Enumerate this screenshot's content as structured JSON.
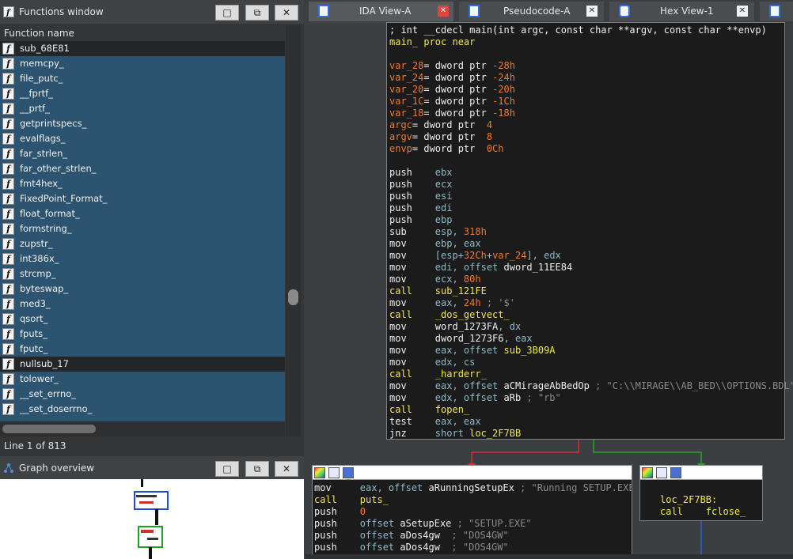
{
  "functions_window": {
    "title": "Functions window",
    "column_header": "Function name",
    "items": [
      "sub_68E81",
      "memcpy_",
      "file_putc_",
      "__fprtf_",
      "__prtf_",
      "getprintspecs_",
      "evalflags_",
      "far_strlen_",
      "far_other_strlen_",
      "fmt4hex_",
      "FixedPoint_Format_",
      "float_format_",
      "formstring_",
      "zupstr_",
      "int386x_",
      "strcmp_",
      "byteswap_",
      "med3_",
      "qsort_",
      "fputs_",
      "fputc_",
      "nullsub_17",
      "tolower_",
      "__set_errno_",
      "__set_doserrno_"
    ],
    "icon_glyph": "f",
    "status": "Line 1 of 813",
    "btn_max": "□",
    "btn_restore": "⧉",
    "btn_close": "✕"
  },
  "graph_overview": {
    "title": "Graph overview",
    "btn_max": "□",
    "btn_restore": "⧉",
    "btn_close": "✕"
  },
  "tabs": [
    {
      "label": "IDA View-A",
      "active": true
    },
    {
      "label": "Pseudocode-A",
      "active": false
    },
    {
      "label": "Hex View-1",
      "active": false
    }
  ],
  "close_glyph": "✕",
  "main_block_lines": [
    [
      {
        "t": "; int __cdecl main(int argc, const char **argv, const char **envp)",
        "c": "c-white"
      }
    ],
    [
      {
        "t": "main_ proc near",
        "c": "c-yellow"
      }
    ],
    [
      {
        "t": "",
        "c": "c-white"
      }
    ],
    [
      {
        "t": "var_28",
        "c": "c-orange"
      },
      {
        "t": "= dword ptr ",
        "c": "c-white"
      },
      {
        "t": "-28h",
        "c": "c-orange"
      }
    ],
    [
      {
        "t": "var_24",
        "c": "c-orange"
      },
      {
        "t": "= dword ptr ",
        "c": "c-white"
      },
      {
        "t": "-24h",
        "c": "c-orange"
      }
    ],
    [
      {
        "t": "var_20",
        "c": "c-orange"
      },
      {
        "t": "= dword ptr ",
        "c": "c-white"
      },
      {
        "t": "-20h",
        "c": "c-orange"
      }
    ],
    [
      {
        "t": "var_1C",
        "c": "c-orange"
      },
      {
        "t": "= dword ptr ",
        "c": "c-white"
      },
      {
        "t": "-1Ch",
        "c": "c-orange"
      }
    ],
    [
      {
        "t": "var_18",
        "c": "c-orange"
      },
      {
        "t": "= dword ptr ",
        "c": "c-white"
      },
      {
        "t": "-18h",
        "c": "c-orange"
      }
    ],
    [
      {
        "t": "argc",
        "c": "c-orange"
      },
      {
        "t": "= dword ptr  ",
        "c": "c-white"
      },
      {
        "t": "4",
        "c": "c-orange"
      }
    ],
    [
      {
        "t": "argv",
        "c": "c-orange"
      },
      {
        "t": "= dword ptr  ",
        "c": "c-white"
      },
      {
        "t": "8",
        "c": "c-orange"
      }
    ],
    [
      {
        "t": "envp",
        "c": "c-orange"
      },
      {
        "t": "= dword ptr  ",
        "c": "c-white"
      },
      {
        "t": "0Ch",
        "c": "c-orange"
      }
    ],
    [
      {
        "t": "",
        "c": "c-white"
      }
    ],
    [
      {
        "t": "push    ",
        "c": "c-white"
      },
      {
        "t": "ebx",
        "c": "c-teal"
      }
    ],
    [
      {
        "t": "push    ",
        "c": "c-white"
      },
      {
        "t": "ecx",
        "c": "c-teal"
      }
    ],
    [
      {
        "t": "push    ",
        "c": "c-white"
      },
      {
        "t": "esi",
        "c": "c-teal"
      }
    ],
    [
      {
        "t": "push    ",
        "c": "c-white"
      },
      {
        "t": "edi",
        "c": "c-teal"
      }
    ],
    [
      {
        "t": "push    ",
        "c": "c-white"
      },
      {
        "t": "ebp",
        "c": "c-teal"
      }
    ],
    [
      {
        "t": "sub     ",
        "c": "c-white"
      },
      {
        "t": "esp, ",
        "c": "c-teal"
      },
      {
        "t": "318h",
        "c": "c-orange"
      }
    ],
    [
      {
        "t": "mov     ",
        "c": "c-white"
      },
      {
        "t": "ebp, eax",
        "c": "c-teal"
      }
    ],
    [
      {
        "t": "mov     ",
        "c": "c-white"
      },
      {
        "t": "[esp+",
        "c": "c-teal"
      },
      {
        "t": "32Ch",
        "c": "c-orange"
      },
      {
        "t": "+",
        "c": "c-teal"
      },
      {
        "t": "var_24",
        "c": "c-orange"
      },
      {
        "t": "], edx",
        "c": "c-teal"
      }
    ],
    [
      {
        "t": "mov     ",
        "c": "c-white"
      },
      {
        "t": "edi, offset ",
        "c": "c-teal"
      },
      {
        "t": "dword_11EE84",
        "c": "c-white"
      }
    ],
    [
      {
        "t": "mov     ",
        "c": "c-white"
      },
      {
        "t": "ecx, ",
        "c": "c-teal"
      },
      {
        "t": "80h",
        "c": "c-orange"
      }
    ],
    [
      {
        "t": "call    ",
        "c": "c-yellow"
      },
      {
        "t": "sub_121FE",
        "c": "c-yellow"
      }
    ],
    [
      {
        "t": "mov     ",
        "c": "c-white"
      },
      {
        "t": "eax, ",
        "c": "c-teal"
      },
      {
        "t": "24h",
        "c": "c-orange"
      },
      {
        "t": " ; '$'",
        "c": "c-cmt"
      }
    ],
    [
      {
        "t": "call    ",
        "c": "c-yellow"
      },
      {
        "t": "_dos_getvect_",
        "c": "c-yellow"
      }
    ],
    [
      {
        "t": "mov     ",
        "c": "c-white"
      },
      {
        "t": "word_1273FA",
        "c": "c-white"
      },
      {
        "t": ", dx",
        "c": "c-teal"
      }
    ],
    [
      {
        "t": "mov     ",
        "c": "c-white"
      },
      {
        "t": "dword_1273F6",
        "c": "c-white"
      },
      {
        "t": ", eax",
        "c": "c-teal"
      }
    ],
    [
      {
        "t": "mov     ",
        "c": "c-white"
      },
      {
        "t": "eax, offset ",
        "c": "c-teal"
      },
      {
        "t": "sub_3B09A",
        "c": "c-yellow"
      }
    ],
    [
      {
        "t": "mov     ",
        "c": "c-white"
      },
      {
        "t": "edx, cs",
        "c": "c-teal"
      }
    ],
    [
      {
        "t": "call    ",
        "c": "c-yellow"
      },
      {
        "t": "_harderr_",
        "c": "c-yellow"
      }
    ],
    [
      {
        "t": "mov     ",
        "c": "c-white"
      },
      {
        "t": "eax, offset ",
        "c": "c-teal"
      },
      {
        "t": "aCMirageAbBedOp",
        "c": "c-white"
      },
      {
        "t": " ; \"C:\\\\MIRAGE\\\\AB_BED\\\\OPTIONS.BDL\"",
        "c": "c-cmt"
      }
    ],
    [
      {
        "t": "mov     ",
        "c": "c-white"
      },
      {
        "t": "edx, offset ",
        "c": "c-teal"
      },
      {
        "t": "aRb",
        "c": "c-white"
      },
      {
        "t": " ; \"rb\"",
        "c": "c-cmt"
      }
    ],
    [
      {
        "t": "call    ",
        "c": "c-yellow"
      },
      {
        "t": "fopen_",
        "c": "c-yellow"
      }
    ],
    [
      {
        "t": "test    ",
        "c": "c-white"
      },
      {
        "t": "eax, eax",
        "c": "c-teal"
      }
    ],
    [
      {
        "t": "jnz     ",
        "c": "c-white"
      },
      {
        "t": "short ",
        "c": "c-teal"
      },
      {
        "t": "loc_2F7BB",
        "c": "c-yellow"
      }
    ]
  ],
  "block_a_lines": [
    [
      {
        "t": "mov     ",
        "c": "c-white"
      },
      {
        "t": "eax, offset ",
        "c": "c-teal"
      },
      {
        "t": "aRunningSetupEx",
        "c": "c-white"
      },
      {
        "t": " ; \"Running SETUP.EXE\"",
        "c": "c-cmt"
      }
    ],
    [
      {
        "t": "call    ",
        "c": "c-yellow"
      },
      {
        "t": "puts_",
        "c": "c-yellow"
      }
    ],
    [
      {
        "t": "push    ",
        "c": "c-white"
      },
      {
        "t": "0",
        "c": "c-orange"
      }
    ],
    [
      {
        "t": "push    ",
        "c": "c-white"
      },
      {
        "t": "offset ",
        "c": "c-teal"
      },
      {
        "t": "aSetupExe",
        "c": "c-white"
      },
      {
        "t": " ; \"SETUP.EXE\"",
        "c": "c-cmt"
      }
    ],
    [
      {
        "t": "push    ",
        "c": "c-white"
      },
      {
        "t": "offset ",
        "c": "c-teal"
      },
      {
        "t": "aDos4gw",
        "c": "c-white"
      },
      {
        "t": "  ; \"DOS4GW\"",
        "c": "c-cmt"
      }
    ],
    [
      {
        "t": "push    ",
        "c": "c-white"
      },
      {
        "t": "offset ",
        "c": "c-teal"
      },
      {
        "t": "aDos4gw",
        "c": "c-white"
      },
      {
        "t": "  ; \"DOS4GW\"",
        "c": "c-cmt"
      }
    ]
  ],
  "block_b_lines": [
    [
      {
        "t": "",
        "c": "c-white"
      }
    ],
    [
      {
        "t": "loc_2F7BB:",
        "c": "c-yellow"
      }
    ],
    [
      {
        "t": "call    ",
        "c": "c-yellow"
      },
      {
        "t": "fclose_",
        "c": "c-yellow"
      }
    ]
  ],
  "colors": {
    "selection": "#2c5470",
    "edge_false": "#d23030",
    "edge_true": "#2aa02a",
    "edge_down": "#3060d0"
  }
}
